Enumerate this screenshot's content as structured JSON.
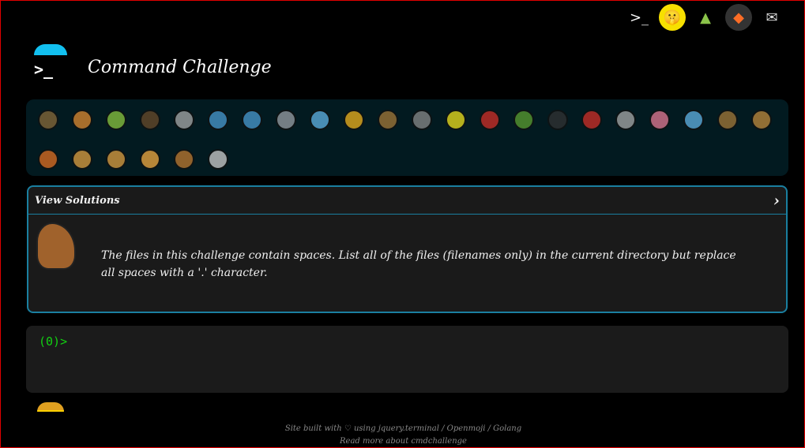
{
  "header": {
    "title": "Command Challenge",
    "logo_prompt": ">_"
  },
  "top_links": [
    {
      "name": "cmdchallenge-icon",
      "glyph": ">_",
      "bg": "#000",
      "color": "#fff"
    },
    {
      "name": "shushing-face-icon",
      "glyph": "🤫",
      "bg": "#f7e000",
      "color": "#000"
    },
    {
      "name": "tree-icon",
      "glyph": "▲",
      "bg": "#000",
      "color": "#8bc34a"
    },
    {
      "name": "gitlab-icon",
      "glyph": "◆",
      "bg": "#333",
      "color": "#fc6d26"
    },
    {
      "name": "mail-icon",
      "glyph": "✉",
      "bg": "#000",
      "color": "#ddd"
    }
  ],
  "animals": [
    {
      "name": "snail",
      "color": "#8a6a3a"
    },
    {
      "name": "butterfly",
      "color": "#e08a30"
    },
    {
      "name": "caterpillar",
      "color": "#8cc63f"
    },
    {
      "name": "ant",
      "color": "#6a4a2a"
    },
    {
      "name": "spider-web",
      "color": "#aaaaaa"
    },
    {
      "name": "spouting-whale",
      "color": "#4a9ad0"
    },
    {
      "name": "whale",
      "color": "#4a9ad0"
    },
    {
      "name": "dolphin",
      "color": "#9aa0a6"
    },
    {
      "name": "fish",
      "color": "#61b2e4"
    },
    {
      "name": "tropical-fish",
      "color": "#f1b31c"
    },
    {
      "name": "blowfish",
      "color": "#a57939"
    },
    {
      "name": "wolf",
      "color": "#8a8a8a"
    },
    {
      "name": "bee",
      "color": "#f1e31c"
    },
    {
      "name": "lady-beetle",
      "color": "#d22f27"
    },
    {
      "name": "cricket",
      "color": "#5c9e31"
    },
    {
      "name": "spider",
      "color": "#333333"
    },
    {
      "name": "scorpion",
      "color": "#d22f27"
    },
    {
      "name": "fly",
      "color": "#aaaaaa"
    },
    {
      "name": "worm",
      "color": "#e67a94"
    },
    {
      "name": "microbe",
      "color": "#61b2e4"
    },
    {
      "name": "monkey",
      "color": "#a57939"
    },
    {
      "name": "dog",
      "color": "#c18a3c"
    },
    {
      "name": "fox",
      "color": "#e27022"
    },
    {
      "name": "cat",
      "color": "#e0a040"
    },
    {
      "name": "lion",
      "color": "#e0a040"
    },
    {
      "name": "tiger",
      "color": "#f4aa41"
    },
    {
      "name": "horse",
      "color": "#c07a30"
    },
    {
      "name": "unicorn",
      "color": "#d0cfce"
    }
  ],
  "solutions": {
    "label": "View Solutions",
    "chevron": "›",
    "description": "The files in this challenge contain spaces. List all of the files (filenames only) in the current directory but replace all spaces with a '.' character."
  },
  "terminal": {
    "prompt": "(0)>"
  },
  "footer": {
    "line1": "Site built with ♡ using jquery.terminal / Openmoji / Golang",
    "line2": "Read more about cmdchallenge"
  }
}
